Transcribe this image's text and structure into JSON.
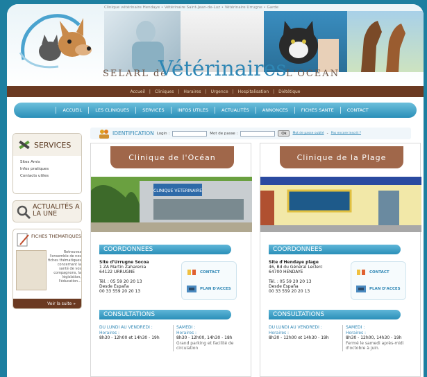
{
  "ticker": "Clinique vétérinaire Hendaye • Vétérinaire Saint-Jean-de-Luz • Vétérinaire Urrugne • Garde",
  "logo": {
    "prefix": "SELARL de",
    "main": "Vétérinaires",
    "suffix": "L'OCEAN"
  },
  "subnav": [
    "Accueil",
    "Cliniques",
    "Horaires",
    "Urgence",
    "Hospitalisation",
    "Diététique"
  ],
  "nav": [
    "ACCUEIL",
    "LES CLINIQUES",
    "SERVICES",
    "INFOS UTILES",
    "ACTUALITÉS",
    "ANNONCES",
    "FICHES SANTE",
    "CONTACT"
  ],
  "sidebar": {
    "services_title": "SERVICES",
    "services_items": [
      "Sites Amis",
      "Infos pratiques",
      "Contacts utiles"
    ],
    "actu_title": "ACTUALITÉS A LA UNE",
    "fiches_title": "FICHES THEMATIQUES",
    "fiches_text": "Retrouvez l'ensemble de nos fiches thématiques concernant la santé de vos compagnons, la législation, l'éducation...",
    "fiches_more": "Voir la suite »"
  },
  "ident": {
    "title": "IDENTIFICATION",
    "login_label": "Login :",
    "password_label": "Mot de passe :",
    "ok": "Ok",
    "forgot": "Mot de passe oublié",
    "register": "Pas encore inscrit ?"
  },
  "clinics": [
    {
      "title": "Clinique de l'Océan",
      "photo_sign": "CLINIQUE VETERINAIRE",
      "coords_label": "COORDONNEES",
      "site_name": "Site d'Urrugne Socoa",
      "address1": "1 ZA Martin Zaharenia",
      "address2": "64122 URRUGNE",
      "phone": "Tél. : 05 59 20 20 13",
      "from_spain": "Desde España",
      "phone_spain": "00 33 559 20 20 13",
      "contact_btn": "CONTACT",
      "plan_btn": "PLAN D'ACCES",
      "consult_label": "CONSULTATIONS",
      "weekday_label": "DU LUNDI AU VENDREDI :",
      "weekday_hours_label": "Horaires :",
      "weekday_hours": "8h30 - 12h00 et 14h30 - 19h",
      "saturday_label": "SAMEDI :",
      "saturday_hours_label": "Horaires :",
      "saturday_hours": "8h30 - 12h00, 14h30 - 18h",
      "note": "Grand parking et facilité de circulation"
    },
    {
      "title": "Clinique de la Plage",
      "coords_label": "COORDONNEES",
      "site_name": "Site d'Hendaye plage",
      "address1": "46, Bd du Général Leclerc",
      "address2": "64700 HENDAYE",
      "phone": "Tél. : 05 59 20 20 13",
      "from_spain": "Desde España",
      "phone_spain": "00 33 559 20 20 13",
      "contact_btn": "CONTACT",
      "plan_btn": "PLAN D'ACCES",
      "consult_label": "CONSULTATIONS",
      "weekday_label": "DU LUNDI AU VENDREDI :",
      "weekday_hours_label": "Horaires :",
      "weekday_hours": "8h30 - 12h00 et 14h30 - 19h",
      "saturday_label": "SAMEDI :",
      "saturday_hours_label": "Horaires :",
      "saturday_hours": "8h30 - 12h00, 14h30 - 19h",
      "note": "Fermé le samedi après-midi d'octobre à juin."
    }
  ]
}
